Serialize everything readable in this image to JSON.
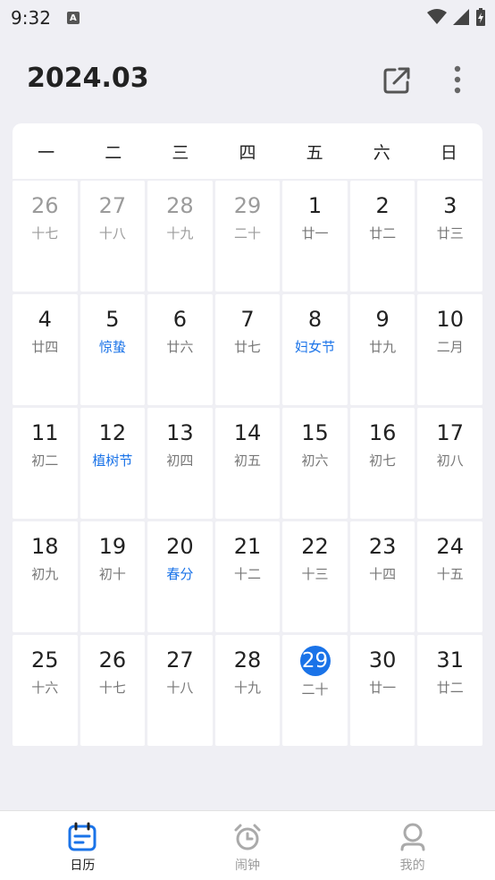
{
  "status": {
    "time": "9:32",
    "indicator": "A"
  },
  "header": {
    "title": "2024.03",
    "share_icon": "share-external-icon",
    "more_icon": "more-vertical-icon"
  },
  "weekdays": [
    "一",
    "二",
    "三",
    "四",
    "五",
    "六",
    "日"
  ],
  "days": [
    {
      "day": "26",
      "lunar": "十七",
      "other": true
    },
    {
      "day": "27",
      "lunar": "十八",
      "other": true
    },
    {
      "day": "28",
      "lunar": "十九",
      "other": true
    },
    {
      "day": "29",
      "lunar": "二十",
      "other": true
    },
    {
      "day": "1",
      "lunar": "廿一"
    },
    {
      "day": "2",
      "lunar": "廿二"
    },
    {
      "day": "3",
      "lunar": "廿三"
    },
    {
      "day": "4",
      "lunar": "廿四"
    },
    {
      "day": "5",
      "lunar": "惊蛰",
      "festival": true
    },
    {
      "day": "6",
      "lunar": "廿六"
    },
    {
      "day": "7",
      "lunar": "廿七"
    },
    {
      "day": "8",
      "lunar": "妇女节",
      "festival": true
    },
    {
      "day": "9",
      "lunar": "廿九"
    },
    {
      "day": "10",
      "lunar": "二月"
    },
    {
      "day": "11",
      "lunar": "初二"
    },
    {
      "day": "12",
      "lunar": "植树节",
      "festival": true
    },
    {
      "day": "13",
      "lunar": "初四"
    },
    {
      "day": "14",
      "lunar": "初五"
    },
    {
      "day": "15",
      "lunar": "初六"
    },
    {
      "day": "16",
      "lunar": "初七"
    },
    {
      "day": "17",
      "lunar": "初八"
    },
    {
      "day": "18",
      "lunar": "初九"
    },
    {
      "day": "19",
      "lunar": "初十"
    },
    {
      "day": "20",
      "lunar": "春分",
      "festival": true
    },
    {
      "day": "21",
      "lunar": "十二"
    },
    {
      "day": "22",
      "lunar": "十三"
    },
    {
      "day": "23",
      "lunar": "十四"
    },
    {
      "day": "24",
      "lunar": "十五"
    },
    {
      "day": "25",
      "lunar": "十六"
    },
    {
      "day": "26",
      "lunar": "十七"
    },
    {
      "day": "27",
      "lunar": "十八"
    },
    {
      "day": "28",
      "lunar": "十九"
    },
    {
      "day": "29",
      "lunar": "二十",
      "today": true
    },
    {
      "day": "30",
      "lunar": "廿一"
    },
    {
      "day": "31",
      "lunar": "廿二"
    }
  ],
  "nav": [
    {
      "label": "日历",
      "icon": "calendar-icon",
      "active": true
    },
    {
      "label": "闹钟",
      "icon": "alarm-clock-icon",
      "active": false
    },
    {
      "label": "我的",
      "icon": "profile-icon",
      "active": false
    }
  ],
  "colors": {
    "accent": "#1a73e8",
    "background": "#efeff4"
  }
}
